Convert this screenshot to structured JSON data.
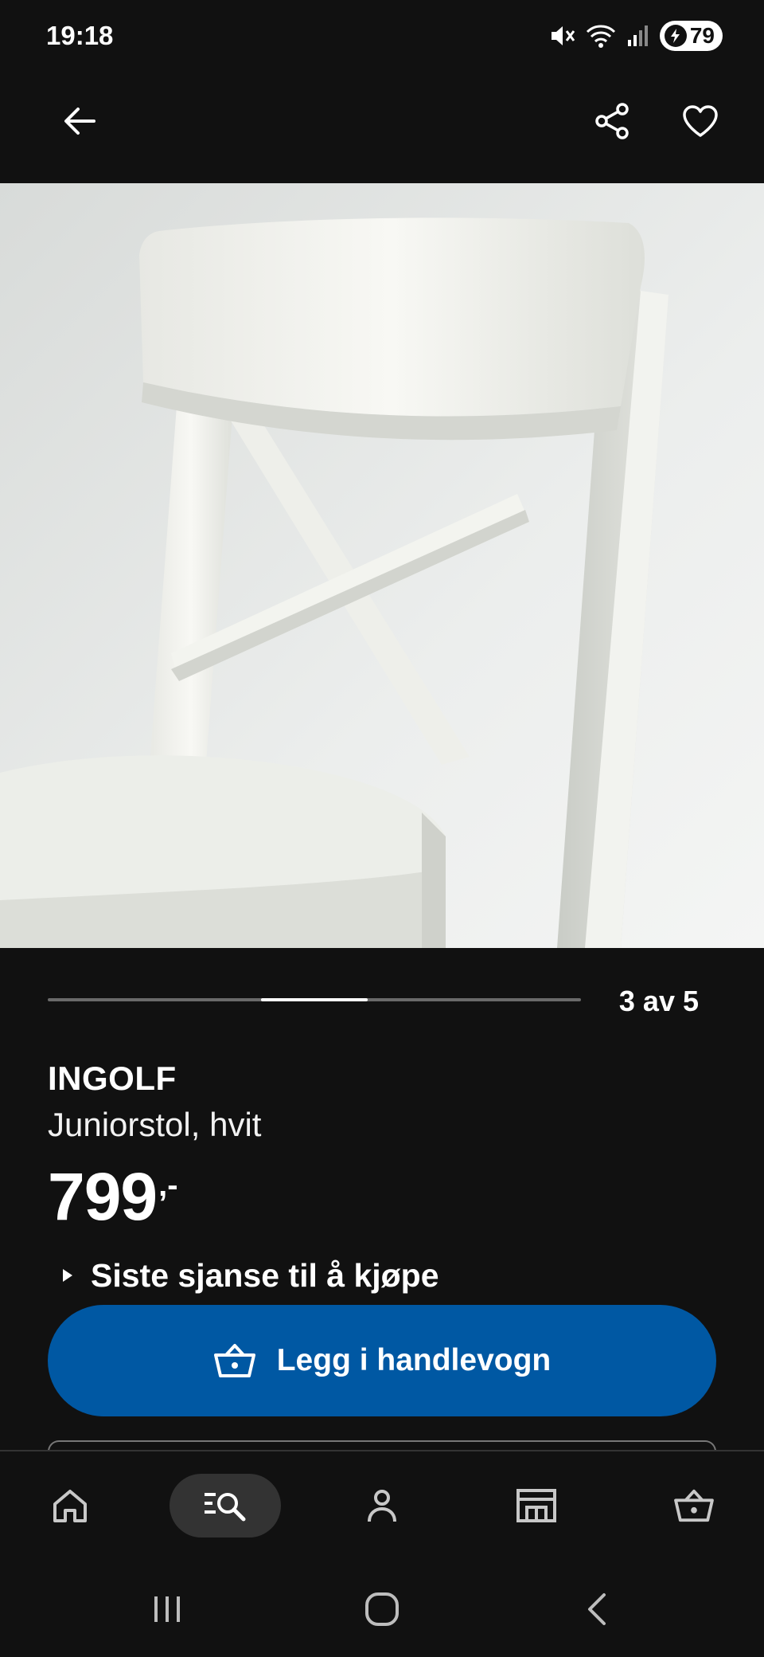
{
  "status_bar": {
    "time": "19:18",
    "battery": "79",
    "icons": [
      "mute-icon",
      "wifi-icon",
      "signal-icon",
      "battery-icon"
    ]
  },
  "top_nav": {
    "icons": [
      "back-arrow-icon",
      "share-icon",
      "heart-icon"
    ]
  },
  "carousel": {
    "current": 3,
    "total": 5,
    "counter_text": "3 av 5"
  },
  "product": {
    "name": "INGOLF",
    "description": "Juniorstol, hvit",
    "price": "799",
    "price_suffix": ",-",
    "notice": "Siste sjanse til å kjøpe"
  },
  "cart_button": {
    "label": "Legg i handlevogn",
    "icon": "basket-icon"
  },
  "bottom_nav": {
    "tabs": [
      {
        "name": "home",
        "icon": "home-icon",
        "active": false
      },
      {
        "name": "search",
        "icon": "search-icon",
        "active": true
      },
      {
        "name": "profile",
        "icon": "profile-icon",
        "active": false
      },
      {
        "name": "store",
        "icon": "store-icon",
        "active": false
      },
      {
        "name": "cart",
        "icon": "basket-icon",
        "active": false
      }
    ]
  },
  "colors": {
    "background": "#111111",
    "accent": "#0058a3",
    "text": "#ffffff",
    "active_tab": "#333333"
  }
}
